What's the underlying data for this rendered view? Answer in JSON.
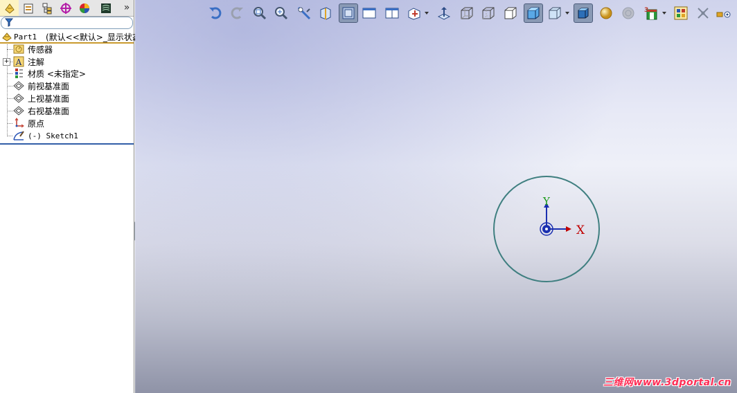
{
  "panel_tabs": [
    {
      "icon": "feature-manager-tab-icon",
      "active": true
    },
    {
      "icon": "property-manager-tab-icon",
      "active": false
    },
    {
      "icon": "configuration-manager-tab-icon",
      "active": false
    },
    {
      "icon": "dimxpert-manager-tab-icon",
      "active": false
    },
    {
      "icon": "display-manager-tab-icon",
      "active": false
    },
    {
      "icon": "layer-tab-icon",
      "active": false
    }
  ],
  "more_tabs_label": "»",
  "filter": {
    "icon": "filter-funnel-icon",
    "value": ""
  },
  "tree": {
    "root": {
      "name": "Part1",
      "config": "(默认<<默认>_显示状态"
    },
    "items": [
      {
        "label": "传感器",
        "icon": "sensor-folder-icon"
      },
      {
        "label": "注解",
        "icon": "annotations-icon",
        "expandable": true,
        "expand_glyph": "+"
      },
      {
        "label": "材质 <未指定>",
        "icon": "material-icon"
      },
      {
        "label": "前视基准面",
        "icon": "plane-icon"
      },
      {
        "label": "上视基准面",
        "icon": "plane-icon"
      },
      {
        "label": "右视基准面",
        "icon": "plane-icon"
      },
      {
        "label": "原点",
        "icon": "origin-icon"
      },
      {
        "label": "(-) Sketch1",
        "icon": "sketch-icon"
      }
    ]
  },
  "view_toolbar": [
    "undo-icon",
    "redo-icon",
    "zoom-to-fit-icon",
    "zoom-to-area-icon",
    "zoom-selection-icon",
    "section-view-icon",
    "single-view-icon",
    "two-view-icon",
    "view-orientation-icon",
    "normal-to-icon",
    "wireframe-icon",
    "hidden-lines-visible-icon",
    "hidden-lines-removed-icon",
    "shaded-with-edges-icon",
    "shaded-icon",
    "display-style-icon",
    "apply-scene-icon",
    "realview-icon",
    "3d-view-icon",
    "view-settings-icon",
    "move-triad-icon",
    "hide-show-icon"
  ],
  "sketch": {
    "axis_x_label": "X",
    "axis_y_label": "Y",
    "circle_color": "#3f7f80",
    "x_axis_color": "#c00000",
    "y_axis_color": "#1a9a1a"
  },
  "watermark": "三维网www.3dportal.cn",
  "colors": {
    "tree_selection_line": "#315ea8",
    "root_underline": "#c99a2e",
    "viewport_top": "#cfd3ec",
    "viewport_bottom": "#8f93a7"
  }
}
